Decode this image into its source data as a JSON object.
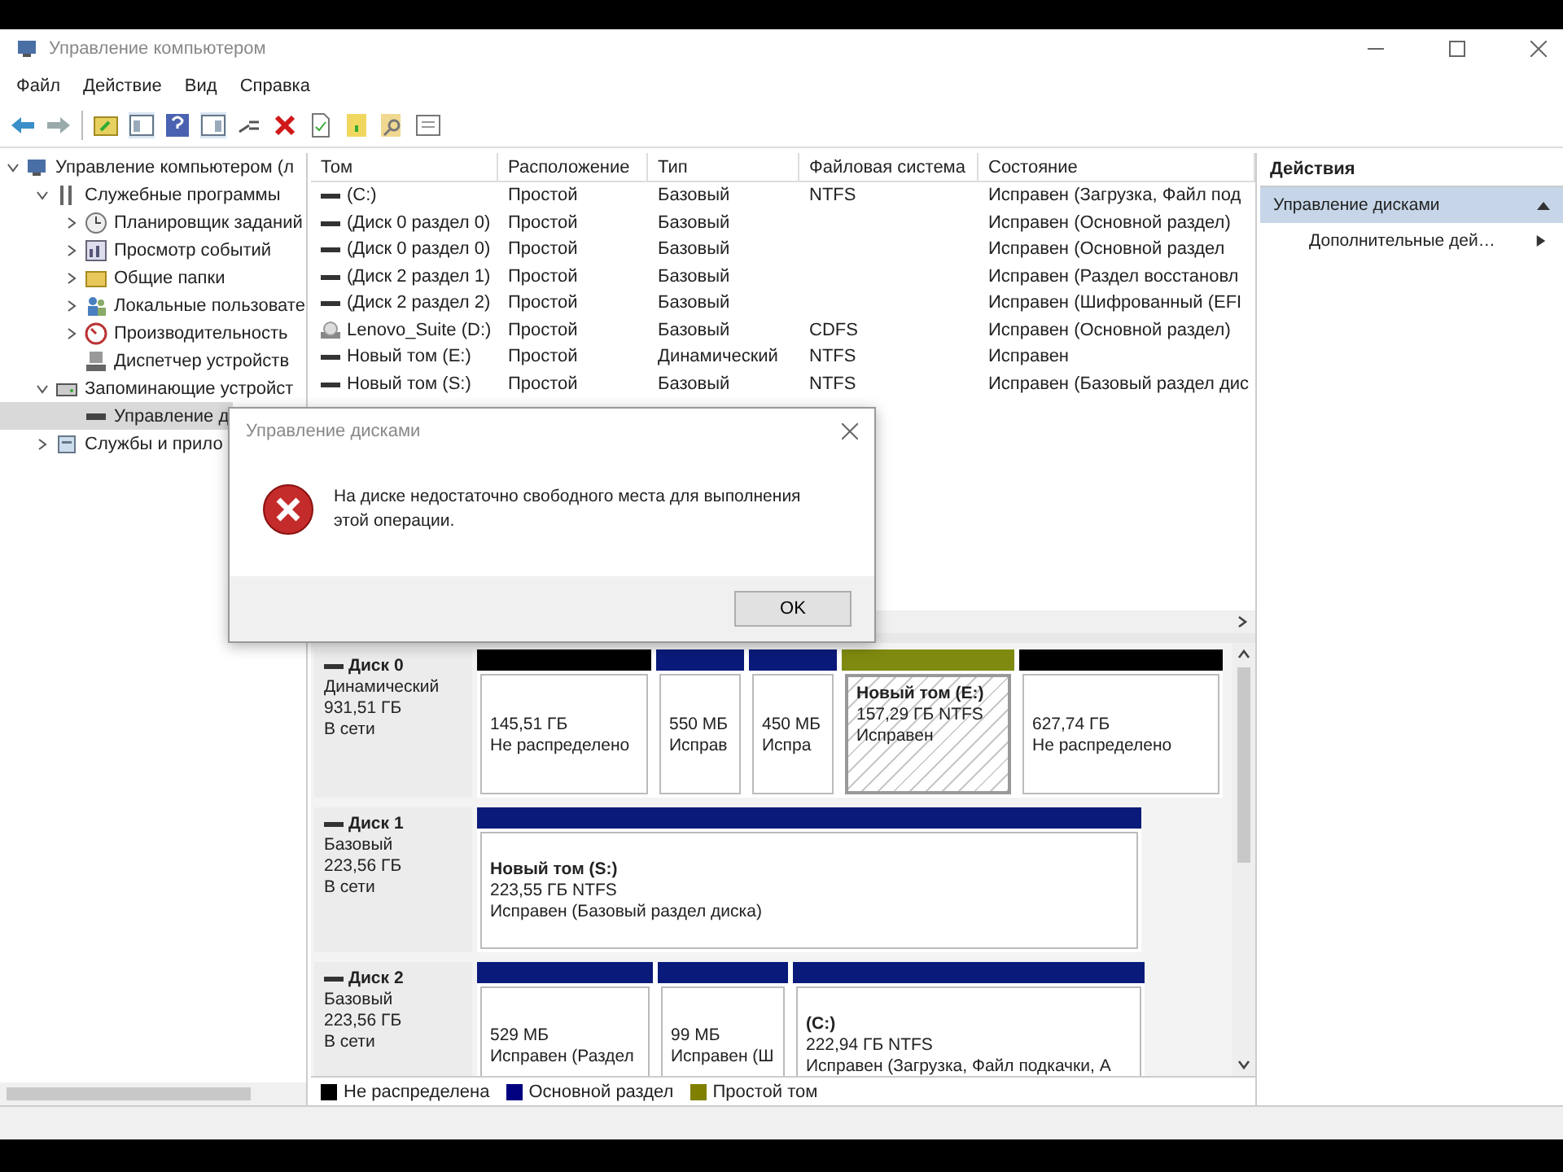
{
  "window": {
    "title": "Управление компьютером"
  },
  "menu": [
    "Файл",
    "Действие",
    "Вид",
    "Справка"
  ],
  "tree": [
    {
      "label": "Управление компьютером (л",
      "selected": false,
      "expanded": true,
      "children": [
        {
          "label": "Служебные программы",
          "selected": false,
          "expanded": true,
          "children": [
            {
              "label": "Планировщик заданий",
              "selected": false,
              "expanded": false
            },
            {
              "label": "Просмотр событий",
              "selected": false,
              "expanded": false
            },
            {
              "label": "Общие папки",
              "selected": false,
              "expanded": false
            },
            {
              "label": "Локальные пользовате",
              "selected": false,
              "expanded": false
            },
            {
              "label": "Производительность",
              "selected": false,
              "expanded": false
            },
            {
              "label": "Диспетчер устройств",
              "selected": false
            }
          ]
        },
        {
          "label": "Запоминающие устройст",
          "selected": false,
          "expanded": true,
          "children": [
            {
              "label": "Управление д",
              "selected": true
            }
          ]
        },
        {
          "label": "Службы и прило",
          "selected": false,
          "expanded": false
        }
      ]
    }
  ],
  "volumes": {
    "columns": [
      "Том",
      "Расположение",
      "Тип",
      "Файловая система",
      "Состояние"
    ],
    "rows": [
      {
        "volume": "(C:)",
        "layout": "Простой",
        "type": "Базовый",
        "file_system": "NTFS",
        "status": "Исправен (Загрузка, Файл под"
      },
      {
        "volume": "(Диск 0 раздел 0)",
        "layout": "Простой",
        "type": "Базовый",
        "status": "Исправен (Основной раздел)"
      },
      {
        "volume": "(Диск 0 раздел 0)",
        "layout": "Простой",
        "type": "Базовый",
        "status": "Исправен (Основной раздел"
      },
      {
        "volume": "(Диск 2 раздел 1)",
        "layout": "Простой",
        "type": "Базовый",
        "status": "Исправен (Раздел восстановл"
      },
      {
        "volume": "(Диск 2 раздел 2)",
        "layout": "Простой",
        "type": "Базовый",
        "status": "Исправен (Шифрованный (EFI"
      },
      {
        "volume": "Lenovo_Suite (D:)",
        "layout": "Простой",
        "type": "Базовый",
        "file_system": "CDFS",
        "status": "Исправен (Основной раздел)"
      },
      {
        "volume": "Новый том (E:)",
        "layout": "Простой",
        "type": "Динамический",
        "file_system": "NTFS",
        "status": "Исправен"
      },
      {
        "volume": "Новый том (S:)",
        "layout": "Простой",
        "type": "Базовый",
        "file_system": "NTFS",
        "status": "Исправен (Базовый раздел дис"
      }
    ]
  },
  "disks": [
    {
      "name": "Диск 0",
      "type": "Динамический",
      "size": "931,51 ГБ",
      "status": "В сети",
      "partitions": [
        {
          "kind": "unallocated",
          "selected": false,
          "lines": [
            "145,51 ГБ",
            "Не распределено"
          ]
        },
        {
          "kind": "primary",
          "selected": false,
          "lines": [
            "550 МБ",
            "Исправ"
          ]
        },
        {
          "kind": "primary",
          "selected": false,
          "lines": [
            "450 МБ",
            "Испра"
          ]
        },
        {
          "kind": "simple",
          "selected": true,
          "title": "Новый том (E:)",
          "lines": [
            "157,29 ГБ NTFS",
            "Исправен"
          ]
        },
        {
          "kind": "unallocated",
          "selected": false,
          "lines": [
            "627,74 ГБ",
            "Не распределено"
          ]
        }
      ]
    },
    {
      "name": "Диск 1",
      "type": "Базовый",
      "size": "223,56 ГБ",
      "status": "В сети",
      "partitions": [
        {
          "kind": "primary",
          "selected": false,
          "title": "Новый том (S:)",
          "lines": [
            "223,55 ГБ NTFS",
            "Исправен (Базовый раздел диска)"
          ]
        }
      ]
    },
    {
      "name": "Диск 2",
      "type": "Базовый",
      "size": "223,56 ГБ",
      "status": "В сети",
      "partitions": [
        {
          "kind": "primary",
          "selected": false,
          "lines": [
            "529 МБ",
            "Исправен (Раздел"
          ]
        },
        {
          "kind": "primary",
          "selected": false,
          "lines": [
            "99 МБ",
            "Исправен (Ш"
          ]
        },
        {
          "kind": "primary",
          "selected": false,
          "title": "(C:)",
          "lines": [
            "222,94 ГБ NTFS",
            "Исправен (Загрузка, Файл подкачки, А"
          ]
        }
      ]
    }
  ],
  "legend": [
    {
      "label": "Не распределена",
      "color": "#000000"
    },
    {
      "label": "Основной раздел",
      "color": "#000080"
    },
    {
      "label": "Простой том",
      "color": "#808000"
    }
  ],
  "actions": {
    "title": "Действия",
    "sections": [
      {
        "label": "Управление дисками",
        "expanded": true,
        "items": [
          "Дополнительные дей…"
        ]
      }
    ]
  },
  "dialog": {
    "title": "Управление дисками",
    "message": "На диске недостаточно свободного места для выполнения этой операции.",
    "button": "OK"
  }
}
